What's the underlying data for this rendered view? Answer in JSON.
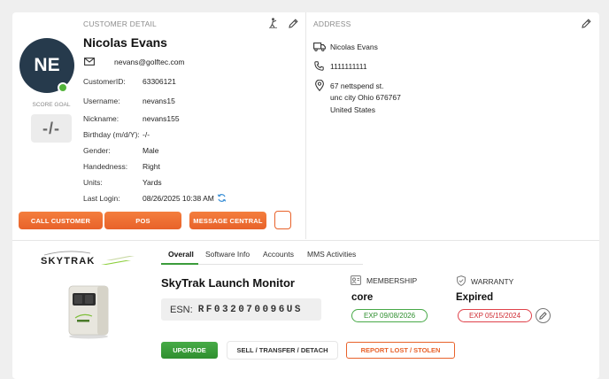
{
  "customer_detail": {
    "section_title": "CUSTOMER DETAIL",
    "initials": "NE",
    "score_goal_label": "SCORE GOAL",
    "score_goal_value": "-/-",
    "name": "Nicolas Evans",
    "email": "nevans@golftec.com",
    "fields": [
      {
        "label": "CustomerID:",
        "value": "63306121"
      },
      {
        "label": "Username:",
        "value": "nevans15"
      },
      {
        "label": "Nickname:",
        "value": "nevans155"
      },
      {
        "label": "Birthday (m/d/Y):",
        "value": "-/-"
      },
      {
        "label": "Gender:",
        "value": "Male"
      },
      {
        "label": "Handedness:",
        "value": "Right"
      },
      {
        "label": "Units:",
        "value": "Yards"
      },
      {
        "label": "Last Login:",
        "value": "08/26/2025 10:38 AM"
      }
    ],
    "buttons": {
      "call": "CALL CUSTOMER",
      "pos": "POS",
      "message": "MESSAGE CENTRAL"
    }
  },
  "address": {
    "section_title": "ADDRESS",
    "name": "Nicolas Evans",
    "phone": "1111111111",
    "line1": "67 nettspend st.",
    "line2": "unc city Ohio 676767",
    "line3": "United States"
  },
  "device": {
    "brand": "SKYTRAK",
    "tabs": [
      "Overall",
      "Software Info",
      "Accounts",
      "MMS Activities"
    ],
    "active_tab": "Overall",
    "product_title": "SkyTrak Launch Monitor",
    "esn_label": "ESN:",
    "esn_value": "RF032070096US",
    "membership_label": "MEMBERSHIP",
    "membership_value": "core",
    "membership_exp": "EXP 09/08/2026",
    "warranty_label": "WARRANTY",
    "warranty_value": "Expired",
    "warranty_exp": "EXP 05/15/2024",
    "buttons": {
      "upgrade": "UPGRADE",
      "sell": "SELL / TRANSFER / DETACH",
      "report": "REPORT LOST / STOLEN"
    }
  },
  "colors": {
    "accent_orange": "#e8622a",
    "accent_green": "#3b9c3b",
    "danger_red": "#e0424a",
    "avatar_navy": "#263a4c"
  }
}
